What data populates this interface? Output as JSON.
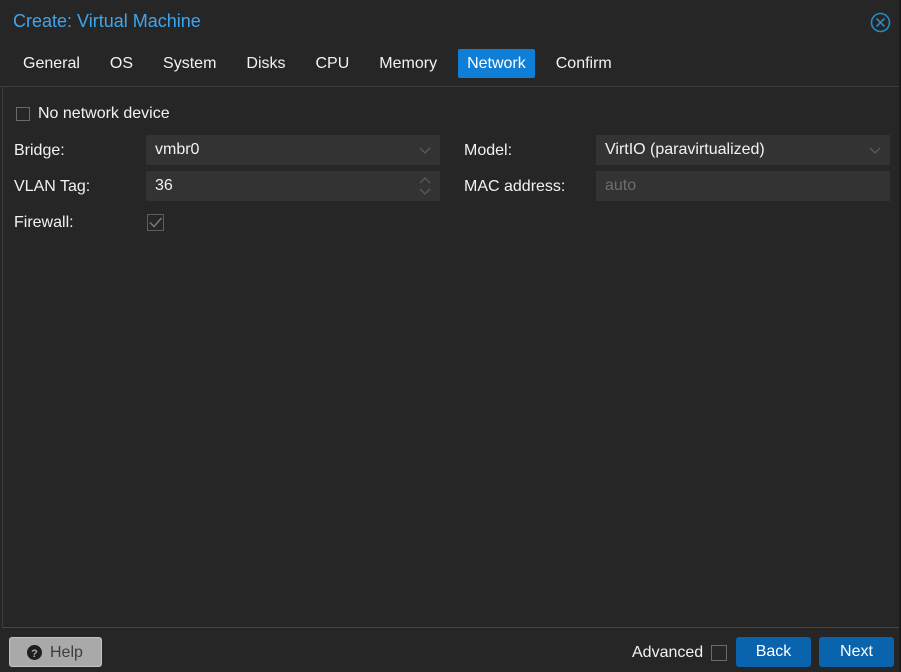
{
  "window": {
    "title": "Create: Virtual Machine",
    "close_icon": "close-circle-icon",
    "accent": "#3fa5ef"
  },
  "tabs": [
    {
      "label": "General",
      "active": false
    },
    {
      "label": "OS",
      "active": false
    },
    {
      "label": "System",
      "active": false
    },
    {
      "label": "Disks",
      "active": false
    },
    {
      "label": "CPU",
      "active": false
    },
    {
      "label": "Memory",
      "active": false
    },
    {
      "label": "Network",
      "active": true
    },
    {
      "label": "Confirm",
      "active": false
    }
  ],
  "form": {
    "no_network_device": {
      "label": "No network device",
      "checked": false
    },
    "bridge": {
      "label": "Bridge:",
      "value": "vmbr0"
    },
    "vlan_tag": {
      "label": "VLAN Tag:",
      "value": "36"
    },
    "firewall": {
      "label": "Firewall:",
      "checked": true
    },
    "model": {
      "label": "Model:",
      "value": "VirtIO (paravirtualized)"
    },
    "mac_address": {
      "label": "MAC address:",
      "value": "",
      "placeholder": "auto"
    }
  },
  "footer": {
    "help_label": "Help",
    "advanced_label": "Advanced",
    "advanced_checked": false,
    "back_label": "Back",
    "next_label": "Next"
  }
}
